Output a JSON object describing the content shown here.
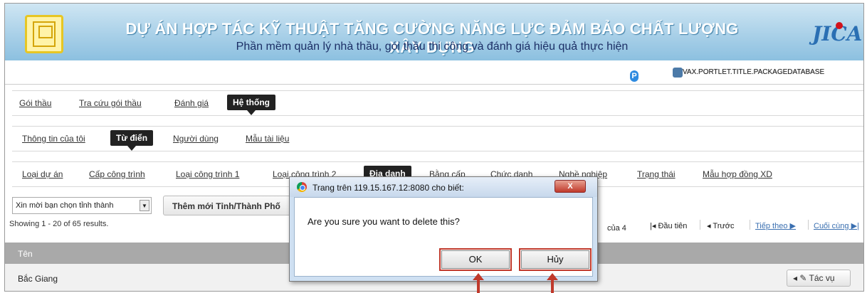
{
  "banner": {
    "title": "DỰ ÁN HỢP TÁC KỸ THUẬT TĂNG CƯỜNG NĂNG LỰC ĐẢM BẢO CHẤT LƯỢNG XÂY DỰNG",
    "subtitle": "Phần mềm quản lý nhà thầu, gói thầu thi công và đánh giá hiệu quả thực hiện",
    "partner_logo_text": "JICA"
  },
  "toolbar": {
    "portlet_title": "VAX.PORTLET.TITLE.PACKAGEDATABASE"
  },
  "nav_main": [
    "Gói thầu",
    "Tra cứu gói thầu",
    "Đánh giá",
    "Hệ thống"
  ],
  "nav_sub": [
    "Thông tin của tôi",
    "Từ điển",
    "Người dùng",
    "Mẫu tài liệu"
  ],
  "nav_dict": [
    "Loại dự án",
    "Cấp công trình",
    "Loại công trình 1",
    "Loại công trình 2",
    "Địa danh",
    "Bằng cấp",
    "Chức danh",
    "Nghề nghiệp",
    "Trạng thái",
    "Mẫu hợp đồng XD"
  ],
  "filter": {
    "province_select": "Xin mời bạn chọn tỉnh thành",
    "add_button": "Thêm mới Tỉnh/Thành Phố"
  },
  "results": {
    "showing": "Showing 1 - 20 of 65 results.",
    "page_of": "của 4",
    "first": "Đầu tiên",
    "prev": "Trước",
    "next": "Tiếp theo",
    "last": "Cuối cùng"
  },
  "table": {
    "column_name": "Tên",
    "rows": [
      {
        "name": "Bắc Giang",
        "action": "Tác vụ"
      }
    ]
  },
  "dialog": {
    "title": "Trang trên 119.15.167.12:8080 cho biết:",
    "close": "X",
    "message": "Are you sure you want to delete this?",
    "ok": "OK",
    "cancel": "Hủy"
  },
  "colors": {
    "banner": "#a9d0e8",
    "active_tab": "#222222",
    "highlight": "#c0392b"
  }
}
